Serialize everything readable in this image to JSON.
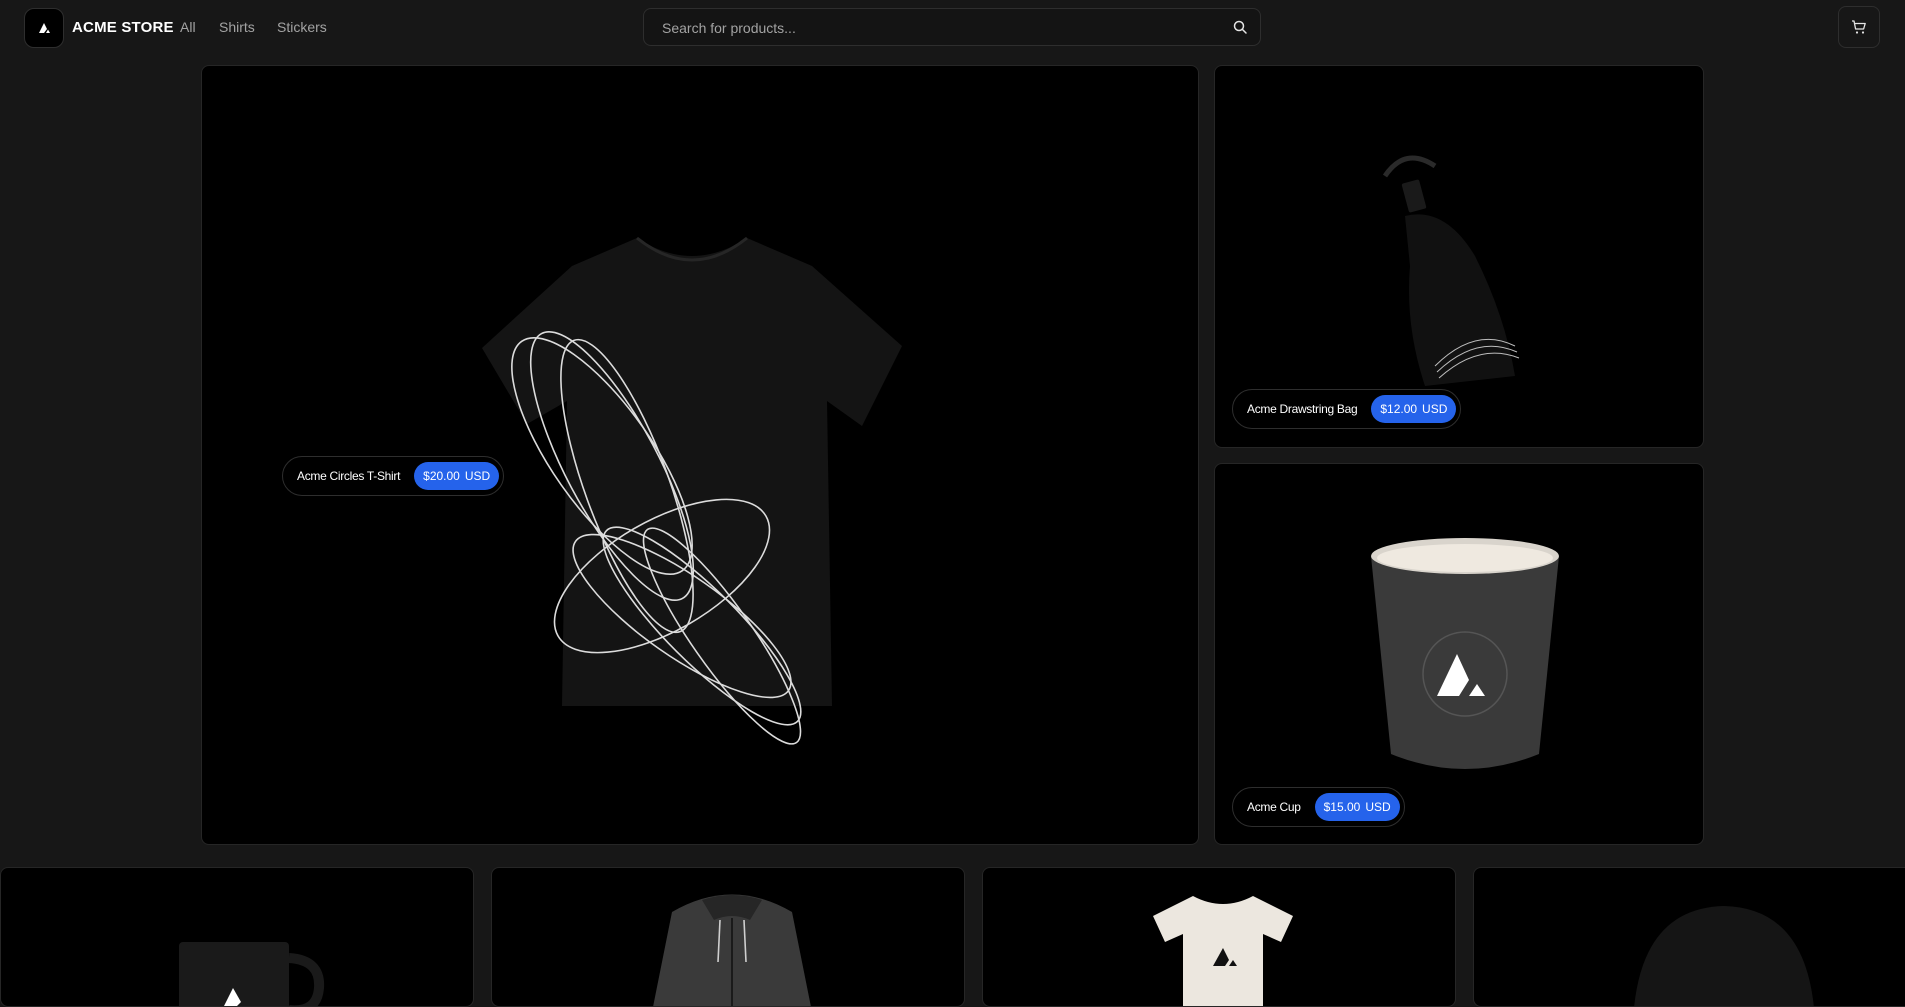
{
  "header": {
    "brand": "ACME STORE",
    "nav": [
      {
        "label": "All"
      },
      {
        "label": "Shirts"
      },
      {
        "label": "Stickers"
      }
    ],
    "search": {
      "placeholder": "Search for products..."
    }
  },
  "featured": [
    {
      "name": "Acme Circles T-Shirt",
      "amount": "$20.00",
      "currency": "USD"
    },
    {
      "name": "Acme Drawstring Bag",
      "amount": "$12.00",
      "currency": "USD"
    },
    {
      "name": "Acme Cup",
      "amount": "$15.00",
      "currency": "USD"
    }
  ],
  "carousel": [
    {
      "item": "mug"
    },
    {
      "item": "hoodie"
    },
    {
      "item": "baby-onesie"
    },
    {
      "item": "beanie"
    }
  ],
  "colors": {
    "accent": "#2563eb",
    "background": "#171717",
    "tile": "#000000"
  }
}
